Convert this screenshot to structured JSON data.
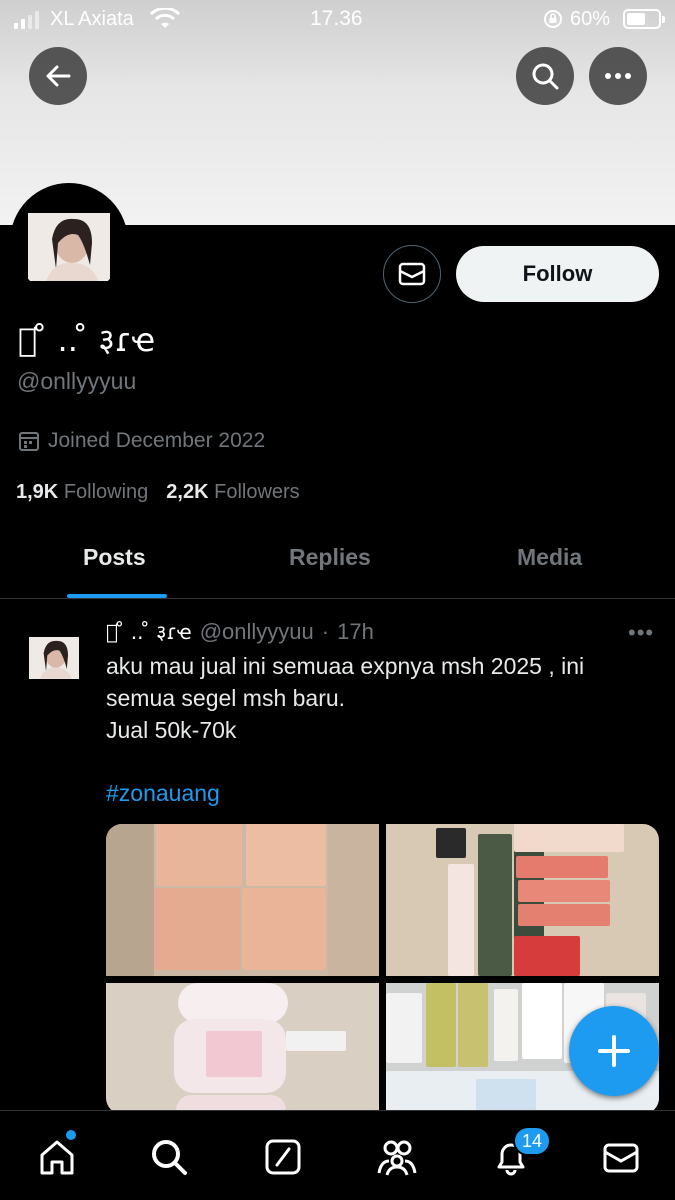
{
  "status_bar": {
    "carrier": "XL Axiata",
    "time": "17.36",
    "battery": "60%",
    "battery_level": 0.6
  },
  "profile": {
    "display_name": "ꨄ͘ ̊ .. ̊ ३ɾҽ",
    "handle": "@onllyyyuu",
    "joined": "Joined December 2022",
    "following_count": "1,9K",
    "following_label": "Following",
    "followers_count": "2,2K",
    "followers_label": "Followers",
    "follow_label": "Follow"
  },
  "tabs": [
    {
      "label": "Posts",
      "active": true
    },
    {
      "label": "Replies",
      "active": false
    },
    {
      "label": "Media",
      "active": false
    }
  ],
  "tweet": {
    "name": "ꨄ͘ ̊ .. ̊ ३ɾҽ",
    "handle": "@onllyyyuu",
    "separator": "·",
    "time": "17h",
    "lines": [
      "aku mau jual ini semuaa expnya msh 2025 , ini",
      "semua segel msh baru.",
      "Jual 50k-70k"
    ],
    "hashtag": "#zonauang"
  },
  "notifications_badge": "14",
  "colors": {
    "accent": "#1d9bf0",
    "background": "#000000",
    "muted_text": "#71767b",
    "follow_button_bg": "#eff3f4"
  },
  "icons": {
    "back": "arrow-left-icon",
    "search": "search-icon",
    "more": "more-horizontal-icon",
    "message": "envelope-icon",
    "calendar": "calendar-icon",
    "compose": "plus-icon",
    "nav": [
      "home-icon",
      "search-icon",
      "grok-icon",
      "communities-icon",
      "bell-icon",
      "envelope-icon"
    ]
  }
}
